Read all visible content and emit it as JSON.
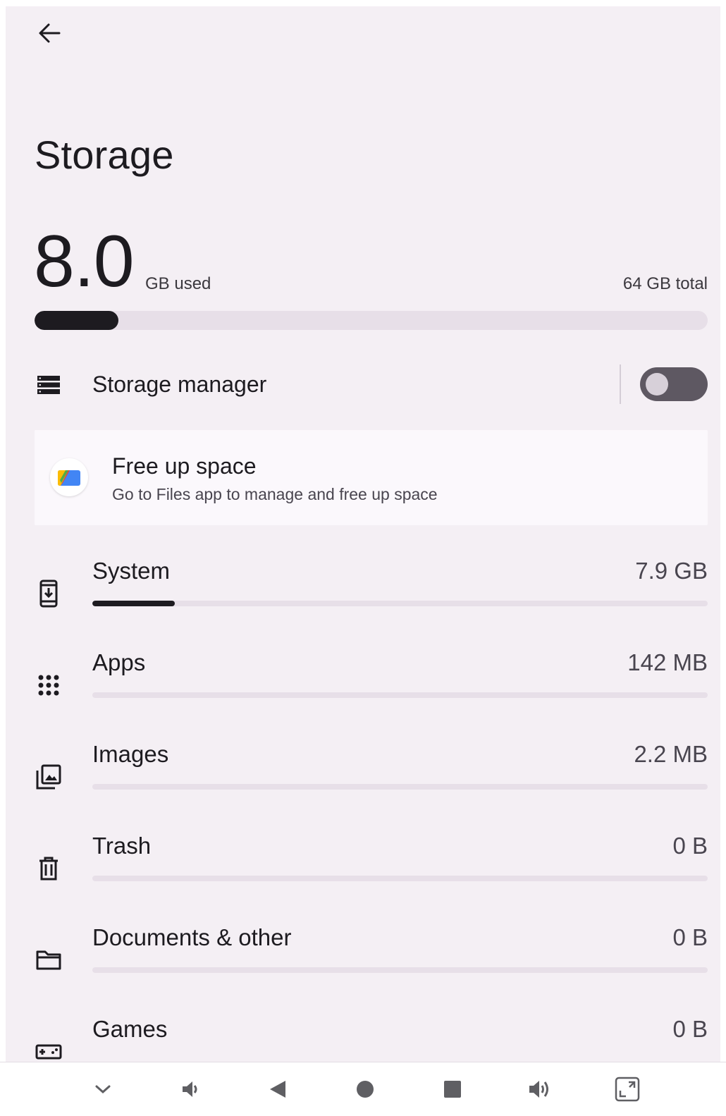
{
  "header": {
    "back_icon": "arrow-back-icon",
    "title": "Storage"
  },
  "summary": {
    "used_value": "8.0",
    "used_unit": "GB used",
    "total": "64 GB total",
    "used_fraction": 0.125
  },
  "storage_manager": {
    "icon": "storage-list-icon",
    "label": "Storage manager",
    "enabled": false
  },
  "free_up_space": {
    "icon": "files-app-logo",
    "title": "Free up space",
    "subtitle": "Go to Files app to manage and free up space"
  },
  "categories": [
    {
      "label": "System",
      "size": "7.9 GB",
      "icon": "system-update-icon",
      "fraction": 0.134
    },
    {
      "label": "Apps",
      "size": "142 MB",
      "icon": "apps-grid-icon",
      "fraction": 0
    },
    {
      "label": "Images",
      "size": "2.2 MB",
      "icon": "photo-library-icon",
      "fraction": 0
    },
    {
      "label": "Trash",
      "size": "0 B",
      "icon": "trash-icon",
      "fraction": 0
    },
    {
      "label": "Documents & other",
      "size": "0 B",
      "icon": "folder-icon",
      "fraction": 0
    },
    {
      "label": "Games",
      "size": "0 B",
      "icon": "gamepad-icon",
      "fraction": 0
    }
  ],
  "nav_bar": {
    "buttons": [
      "chevron-down-icon",
      "volume-down-icon",
      "back-triangle-icon",
      "home-circle-icon",
      "recents-square-icon",
      "volume-up-icon",
      "fullscreen-icon"
    ]
  },
  "colors": {
    "background": "#f4eff4",
    "bar_track": "#e7dfe8",
    "bar_fill": "#1d1b20",
    "toggle_off": "#5e5862"
  }
}
